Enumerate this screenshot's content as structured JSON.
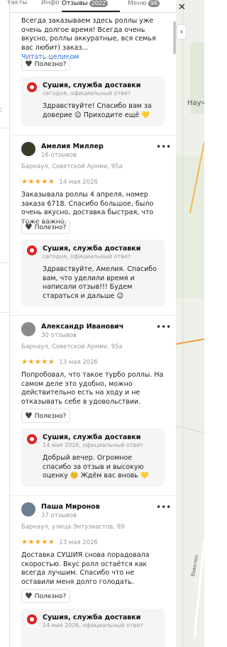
{
  "tabs": {
    "contacts": "такты",
    "info": "Инфо",
    "reviews": "Отзывы",
    "reviews_count": "2022",
    "menu": "Меню",
    "menu_count": "98"
  },
  "map": {
    "label": "Науч",
    "road": "Вавилон"
  },
  "left_strip": {
    "text": "с"
  },
  "useful_label": "Полезно?",
  "read_more": "Читать целиком",
  "reviews": [
    {
      "text": "Всегда заказываем здесь роллы уже очень долгое время! Всегда очень вкусно, роллы аккуратные, вся семья вас любит) заказ...",
      "reply": {
        "name": "Сушия, служба доставки",
        "meta": "сегодня, официальный ответ",
        "text": "Здравствуйте! Спасибо вам за доверие 😉 Приходите ещё 💛"
      }
    },
    {
      "author": "Амелия Миллер",
      "count": "16 отзывов",
      "address": "Барнаул, Советской Армии, 95а",
      "stars": "★★★★★",
      "date": "14 мая 2026",
      "text": "Заказывала роллы 4 апреля, номер заказа 6718. Спасибо большое, было очень вкусно, доставка быстрая, что тоже важно.",
      "reply": {
        "name": "Сушия, служба доставки",
        "meta": "сегодня, официальный ответ",
        "text": "Здравствуйте, Амелия. Спасибо вам, что уделили время и написали отзыв!!! Будем стараться и дальше 😉"
      }
    },
    {
      "author": "Александр Иванович",
      "count": "30 отзывов",
      "address": "Барнаул, Советской Армии, 95а",
      "stars": "★★★★★",
      "date": "13 мая 2026",
      "text": "Попробовал, что такое турбо роллы. На самом деле это удобно, можно действительно есть на ходу и не отказывать себе в удовольствии.",
      "reply": {
        "name": "Сушия, служба доставки",
        "meta": "14 мая 2026, официальный ответ",
        "text": "Добрый вечер. Огромное спасибо за отзыв и высокую оценку ☺️ Ждём вас вновь 💛"
      }
    },
    {
      "author": "Паша Миронов",
      "count": "37 отзывов",
      "address": "Барнаул, улица Энтузиастов, 69",
      "stars": "★★★★★",
      "date": "13 мая 2026",
      "text": "Доставка СУШИЯ снова порадовала скоростью. Вкус ролл остаётся как всегда лучшим. Спасибо что не оставили меня долго голодать.",
      "reply": {
        "name": "Сушия, служба доставки",
        "meta": "14 мая 2026, официальный ответ"
      }
    }
  ],
  "colors": {
    "star": "#f5a623",
    "link": "#1a6ad9",
    "brand": "#e02020"
  }
}
